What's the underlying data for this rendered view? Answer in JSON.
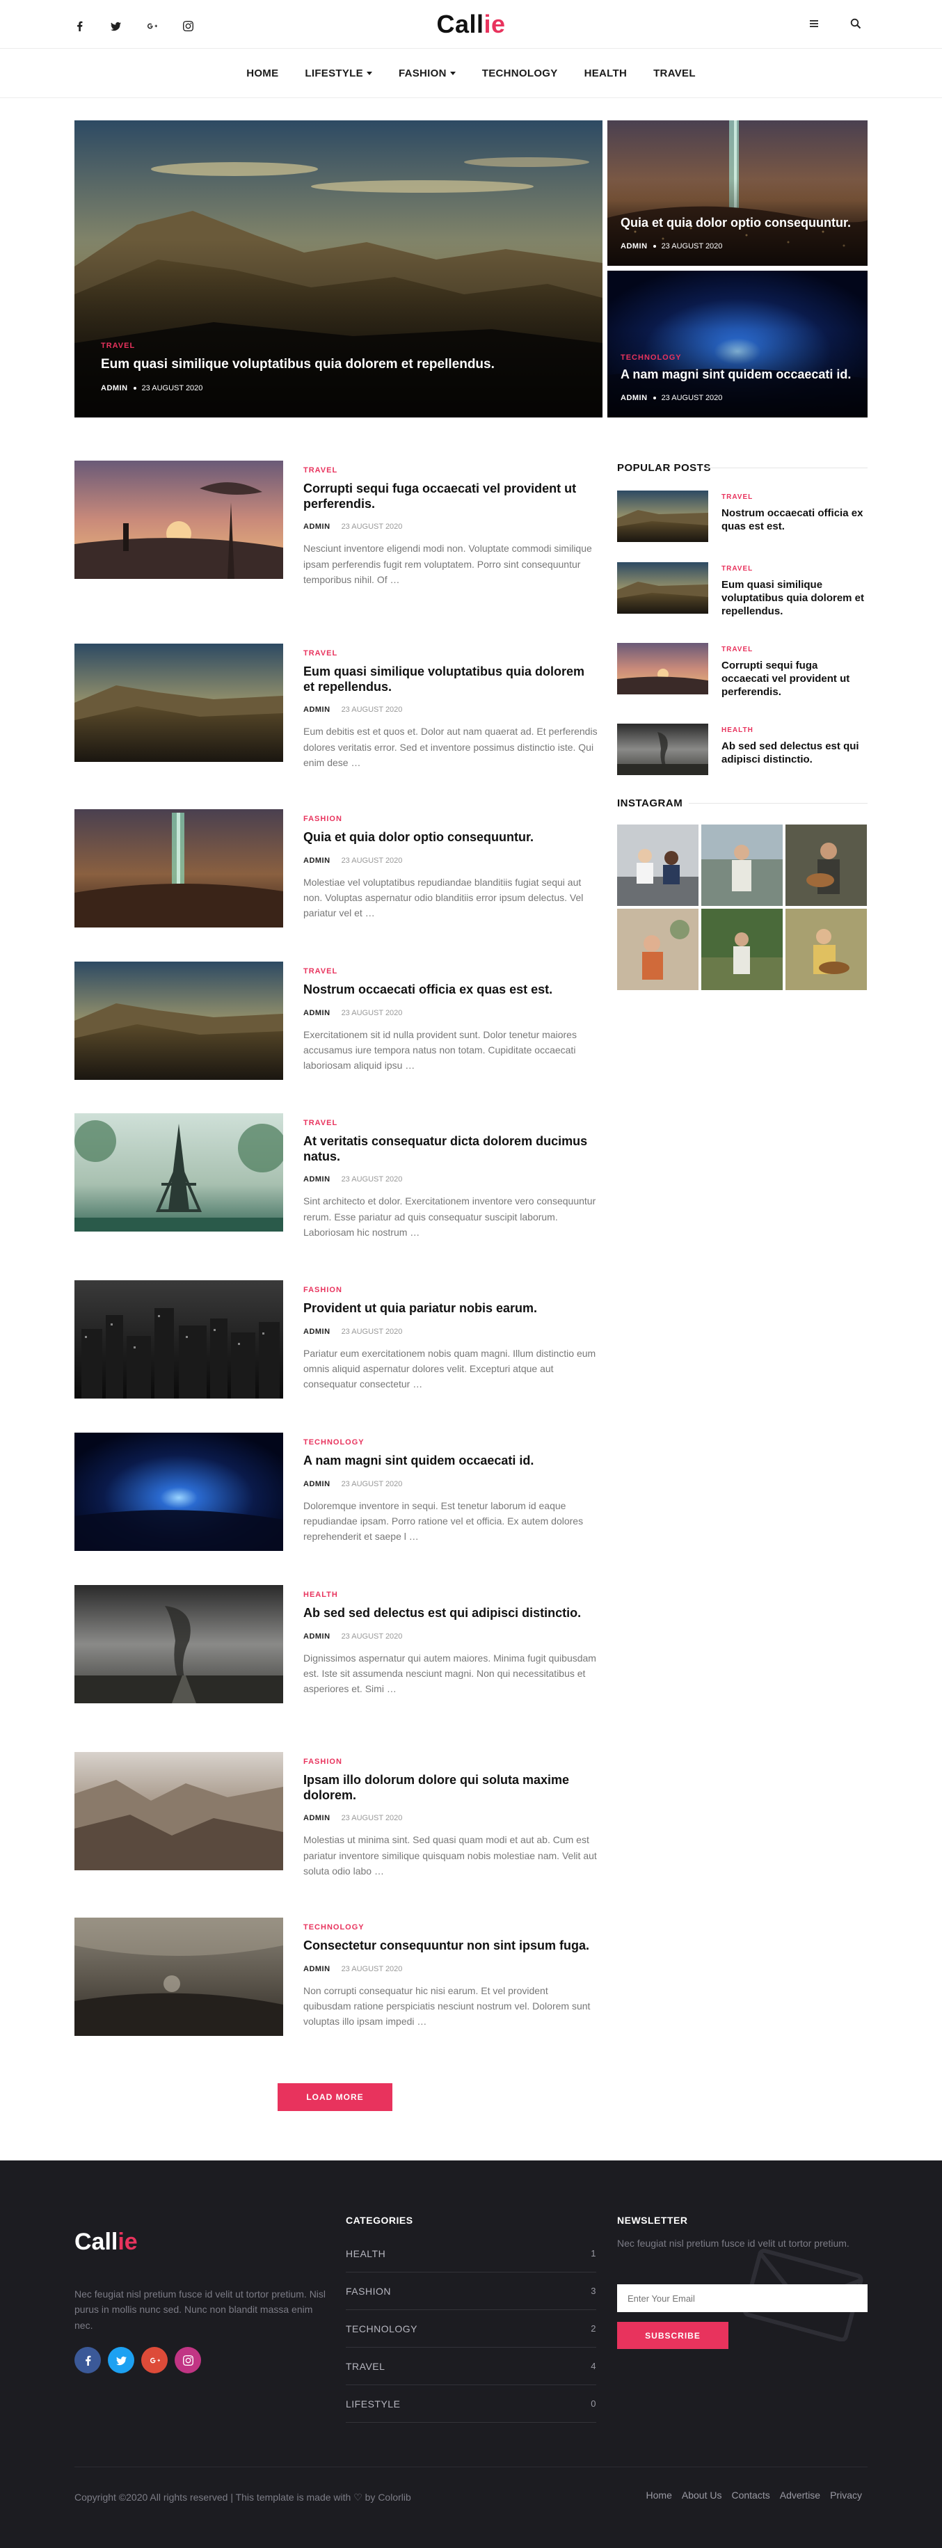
{
  "brand": {
    "logo_main": "Call",
    "logo_accent": "ie"
  },
  "header": {
    "social_icons": [
      "facebook-icon",
      "twitter-icon",
      "google-plus-icon",
      "instagram-icon"
    ],
    "right_icons": [
      "menu-icon",
      "search-icon"
    ]
  },
  "nav": {
    "items": [
      {
        "label": "HOME",
        "dropdown": false
      },
      {
        "label": "LIFESTYLE",
        "dropdown": true
      },
      {
        "label": "FASHION",
        "dropdown": true
      },
      {
        "label": "TECHNOLOGY",
        "dropdown": false
      },
      {
        "label": "HEALTH",
        "dropdown": false
      },
      {
        "label": "TRAVEL",
        "dropdown": false
      }
    ]
  },
  "hero": {
    "main": {
      "category": "TRAVEL",
      "title": "Eum quasi similique voluptatibus quia dolorem et repellendus.",
      "author": "ADMIN",
      "date": "23 AUGUST 2020"
    },
    "side1": {
      "category": "",
      "title": "Quia et quia dolor optio consequuntur.",
      "author": "ADMIN",
      "date": "23 AUGUST 2020"
    },
    "side2": {
      "category": "TECHNOLOGY",
      "title": "A nam magni sint quidem occaecati id.",
      "author": "ADMIN",
      "date": "23 AUGUST 2020"
    }
  },
  "posts": [
    {
      "category": "TRAVEL",
      "title": "Corrupti sequi fuga occaecati vel provident ut perferendis.",
      "author": "ADMIN",
      "date": "23 AUGUST 2020",
      "excerpt": "Nesciunt inventore eligendi modi non. Voluptate commodi similique ipsam perferendis fugit rem voluptatem. Porro sint consequuntur temporibus nihil. Of …"
    },
    {
      "category": "TRAVEL",
      "title": "Eum quasi similique voluptatibus quia dolorem et repellendus.",
      "author": "ADMIN",
      "date": "23 AUGUST 2020",
      "excerpt": "Eum debitis est et quos et. Dolor aut nam quaerat ad. Et perferendis dolores veritatis error. Sed et inventore possimus distinctio iste. Qui enim dese …"
    },
    {
      "category": "FASHION",
      "title": "Quia et quia dolor optio consequuntur.",
      "author": "ADMIN",
      "date": "23 AUGUST 2020",
      "excerpt": "Molestiae vel voluptatibus repudiandae blanditiis fugiat sequi aut non. Voluptas aspernatur odio blanditiis error ipsum delectus. Vel pariatur vel et …"
    },
    {
      "category": "TRAVEL",
      "title": "Nostrum occaecati officia ex quas est est.",
      "author": "ADMIN",
      "date": "23 AUGUST 2020",
      "excerpt": "Exercitationem sit id nulla provident sunt. Dolor tenetur maiores accusamus iure tempora natus non totam. Cupiditate occaecati laboriosam aliquid ipsu …"
    },
    {
      "category": "TRAVEL",
      "title": "At veritatis consequatur dicta dolorem ducimus natus.",
      "author": "ADMIN",
      "date": "23 AUGUST 2020",
      "excerpt": "Sint architecto et dolor. Exercitationem inventore vero consequuntur rerum. Esse pariatur ad quis consequatur suscipit laborum. Laboriosam hic nostrum …"
    },
    {
      "category": "FASHION",
      "title": "Provident ut quia pariatur nobis earum.",
      "author": "ADMIN",
      "date": "23 AUGUST 2020",
      "excerpt": "Pariatur eum exercitationem nobis quam magni. Illum distinctio eum omnis aliquid aspernatur dolores velit. Excepturi atque aut consequatur consectetur …"
    },
    {
      "category": "TECHNOLOGY",
      "title": "A nam magni sint quidem occaecati id.",
      "author": "ADMIN",
      "date": "23 AUGUST 2020",
      "excerpt": "Doloremque inventore in sequi. Est tenetur laborum id eaque repudiandae ipsam. Porro ratione vel et officia. Ex autem dolores reprehenderit et saepe l …"
    },
    {
      "category": "HEALTH",
      "title": "Ab sed sed delectus est qui adipisci distinctio.",
      "author": "ADMIN",
      "date": "23 AUGUST 2020",
      "excerpt": "Dignissimos aspernatur qui autem maiores. Minima fugit quibusdam est. Iste sit assumenda nesciunt magni. Non qui necessitatibus et asperiores et. Simi …"
    },
    {
      "category": "FASHION",
      "title": "Ipsam illo dolorum dolore qui soluta maxime dolorem.",
      "author": "ADMIN",
      "date": "23 AUGUST 2020",
      "excerpt": "Molestias ut minima sint. Sed quasi quam modi et aut ab. Cum est pariatur inventore similique quisquam nobis molestiae nam. Velit aut soluta odio labo …"
    },
    {
      "category": "TECHNOLOGY",
      "title": "Consectetur consequuntur non sint ipsum fuga.",
      "author": "ADMIN",
      "date": "23 AUGUST 2020",
      "excerpt": "Non corrupti consequatur hic nisi earum. Et vel provident quibusdam ratione perspiciatis nesciunt nostrum vel. Dolorem sunt voluptas illo ipsam impedi …"
    }
  ],
  "load_more": "LOAD MORE",
  "sidebar": {
    "popular_title": "POPULAR POSTS",
    "popular": [
      {
        "category": "TRAVEL",
        "title": "Nostrum occaecati officia ex quas est est."
      },
      {
        "category": "TRAVEL",
        "title": "Eum quasi similique voluptatibus quia dolorem et repellendus."
      },
      {
        "category": "TRAVEL",
        "title": "Corrupti sequi fuga occaecati vel provident ut perferendis."
      },
      {
        "category": "HEALTH",
        "title": "Ab sed sed delectus est qui adipisci distinctio."
      }
    ],
    "instagram_title": "INSTAGRAM"
  },
  "footer": {
    "logo_main": "Call",
    "logo_accent": "ie",
    "about": "Nec feugiat nisl pretium fusce id velit ut tortor pretium. Nisl purus in mollis nunc sed. Nunc non blandit massa enim nec.",
    "social_icons": [
      "facebook-icon",
      "twitter-icon",
      "google-plus-icon",
      "instagram-icon"
    ],
    "categories_title": "CATEGORIES",
    "categories": [
      {
        "label": "HEALTH",
        "count": "1"
      },
      {
        "label": "FASHION",
        "count": "3"
      },
      {
        "label": "TECHNOLOGY",
        "count": "2"
      },
      {
        "label": "TRAVEL",
        "count": "4"
      },
      {
        "label": "LIFESTYLE",
        "count": "0"
      }
    ],
    "newsletter_title": "NEWSLETTER",
    "newsletter_text": "Nec feugiat nisl pretium fusce id velit ut tortor pretium.",
    "email_placeholder": "Enter Your Email",
    "subscribe_label": "SUBSCRIBE",
    "copyright": "Copyright ©2020 All rights reserved | This template is made with ♡ by Colorlib",
    "links": [
      "Home",
      "About Us",
      "Contacts",
      "Advertise",
      "Privacy"
    ]
  },
  "colors": {
    "accent": "#e8335d",
    "footer_bg": "#1c1c21",
    "facebook": "#3b5998",
    "twitter": "#1da1f2",
    "google": "#dd4b39",
    "instagram": "#c13584"
  }
}
